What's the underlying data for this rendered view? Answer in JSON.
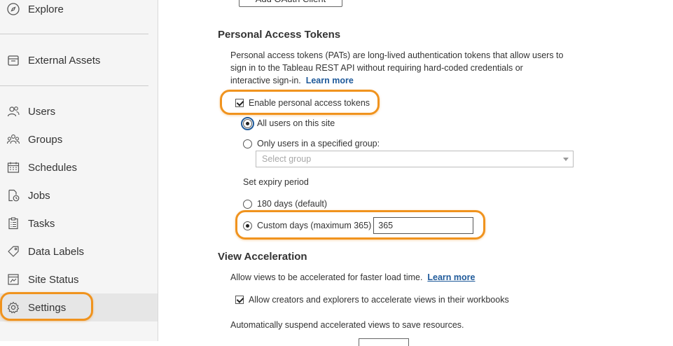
{
  "sidebar": {
    "items": [
      {
        "label": "Explore",
        "icon": "compass-icon"
      },
      {
        "label": "External Assets",
        "icon": "database-icon"
      },
      {
        "label": "Users",
        "icon": "users-icon"
      },
      {
        "label": "Groups",
        "icon": "groups-icon"
      },
      {
        "label": "Schedules",
        "icon": "calendar-icon"
      },
      {
        "label": "Jobs",
        "icon": "jobs-icon"
      },
      {
        "label": "Tasks",
        "icon": "clipboard-icon"
      },
      {
        "label": "Data Labels",
        "icon": "tag-icon"
      },
      {
        "label": "Site Status",
        "icon": "monitor-icon"
      },
      {
        "label": "Settings",
        "icon": "gear-icon"
      }
    ],
    "active": "Settings"
  },
  "main": {
    "oauth_button_label": "Add OAuth Client",
    "pat": {
      "title": "Personal Access Tokens",
      "description": "Personal access tokens (PATs) are long-lived authentication tokens that allow users to sign in to the Tableau REST API without requiring hard-coded credentials or interactive sign-in.",
      "learn_more": "Learn more",
      "enable_label": "Enable personal access tokens",
      "all_users_label": "All users on this site",
      "group_users_label": "Only users in a specified group:",
      "select_placeholder": "Select group",
      "expiry_heading": "Set expiry period",
      "default_days_label": "180 days (default)",
      "custom_days_label": "Custom days (maximum 365)",
      "custom_days_value": "365"
    },
    "view_accel": {
      "title": "View Acceleration",
      "description": "Allow views to be accelerated for faster load time.",
      "learn_more": "Learn more",
      "allow_label": "Allow creators and explorers to accelerate views in their workbooks",
      "suspend_text": "Automatically suspend accelerated views to save resources."
    }
  },
  "colors": {
    "highlight": "#f0931e",
    "link": "#1f5a9a"
  }
}
